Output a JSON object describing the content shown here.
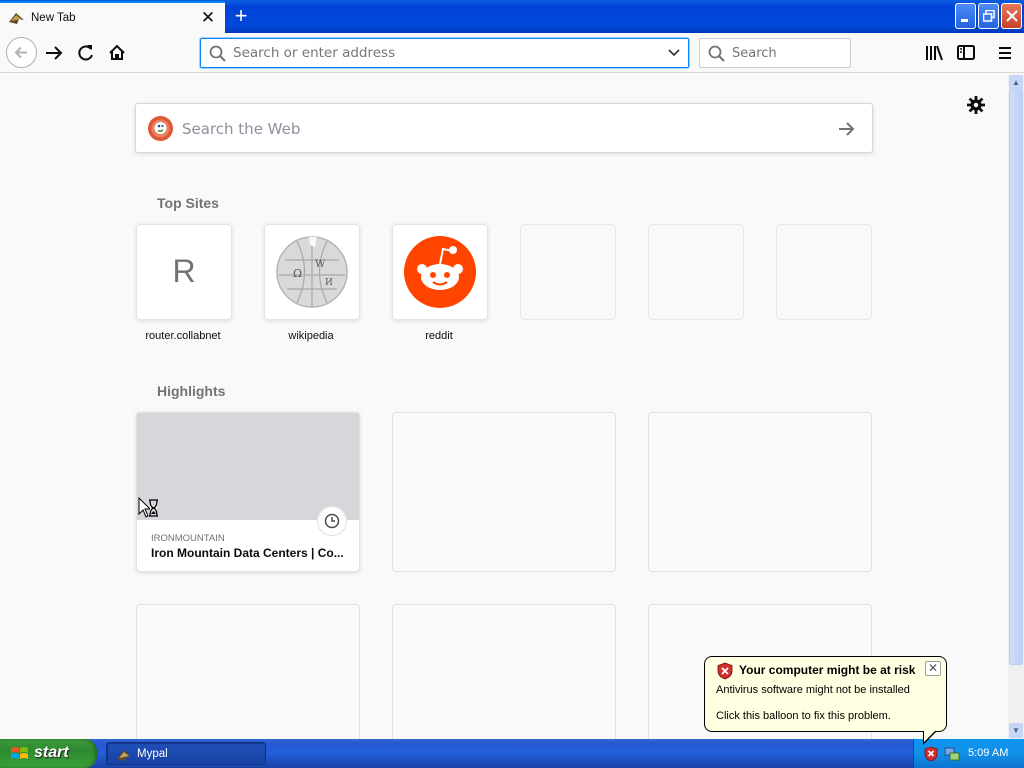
{
  "window": {
    "tab_title": "New Tab",
    "tab_close_icon": "close-icon",
    "new_tab_icon": "plus-icon",
    "controls": [
      "minimize-icon",
      "restore-icon",
      "close-icon"
    ]
  },
  "navbar": {
    "url_placeholder": "Search or enter address",
    "search_placeholder": "Search",
    "icons": [
      "back-icon",
      "forward-icon",
      "reload-icon",
      "home-icon",
      "library-icon",
      "sidebar-icon",
      "menu-icon"
    ]
  },
  "newtab": {
    "web_search_placeholder": "Search the Web",
    "top_sites_title": "Top Sites",
    "top_sites": [
      {
        "label": "router.collabnet",
        "letter": "R"
      },
      {
        "label": "wikipedia"
      },
      {
        "label": "reddit"
      }
    ],
    "highlights_title": "Highlights",
    "highlight": {
      "host": "IRONMOUNTAIN",
      "title": "Iron Mountain Data Centers | Co..."
    }
  },
  "taskbar": {
    "start_label": "start",
    "task_label": "Mypal",
    "clock": "5:09 AM"
  },
  "balloon": {
    "title": "Your computer might be at risk",
    "line1": "Antivirus software might not be installed",
    "line2": "Click this balloon to fix this problem."
  },
  "colors": {
    "accent": "#0a84ff",
    "reddit": "#ff4500",
    "xp_blue": "#245edb",
    "balloon_bg": "#ffffe1"
  }
}
